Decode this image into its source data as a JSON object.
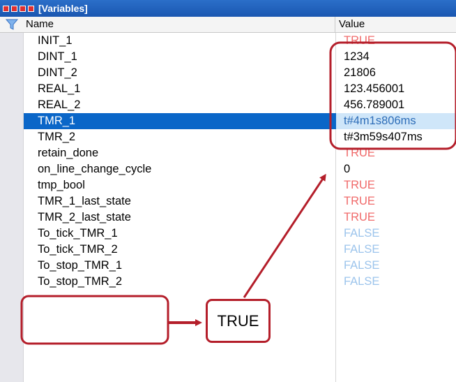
{
  "window": {
    "title": "[Variables]"
  },
  "columns": {
    "name": "Name",
    "value": "Value"
  },
  "rows": [
    {
      "name": "INIT_1",
      "value": "TRUE",
      "kind": "true"
    },
    {
      "name": "DINT_1",
      "value": "1234",
      "kind": "num"
    },
    {
      "name": "DINT_2",
      "value": "21806",
      "kind": "num"
    },
    {
      "name": "REAL_1",
      "value": "123.456001",
      "kind": "num"
    },
    {
      "name": "REAL_2",
      "value": "456.789001",
      "kind": "num"
    },
    {
      "name": "TMR_1",
      "value": "t#4m1s806ms",
      "kind": "time",
      "selected": true
    },
    {
      "name": "TMR_2",
      "value": "t#3m59s407ms",
      "kind": "num"
    },
    {
      "name": "retain_done",
      "value": "TRUE",
      "kind": "true"
    },
    {
      "name": "on_line_change_cycle",
      "value": "0",
      "kind": "num"
    },
    {
      "name": "tmp_bool",
      "value": "TRUE",
      "kind": "true"
    },
    {
      "name": "TMR_1_last_state",
      "value": "TRUE",
      "kind": "true"
    },
    {
      "name": "TMR_2_last_state",
      "value": "TRUE",
      "kind": "true"
    },
    {
      "name": "To_tick_TMR_1",
      "value": "FALSE",
      "kind": "false"
    },
    {
      "name": "To_tick_TMR_2",
      "value": "FALSE",
      "kind": "false"
    },
    {
      "name": "To_stop_TMR_1",
      "value": "FALSE",
      "kind": "false"
    },
    {
      "name": "To_stop_TMR_2",
      "value": "FALSE",
      "kind": "false"
    }
  ],
  "annotation": {
    "callout_text": "TRUE",
    "color": "#b41e2a"
  },
  "colors": {
    "title_bar": "#1a56b0",
    "selection": "#0a66c8",
    "true_value": "#f06a6a",
    "false_value": "#9cc4ec"
  },
  "icons": {
    "filter": "filter-icon",
    "window_squares": "window-squares-icon"
  }
}
